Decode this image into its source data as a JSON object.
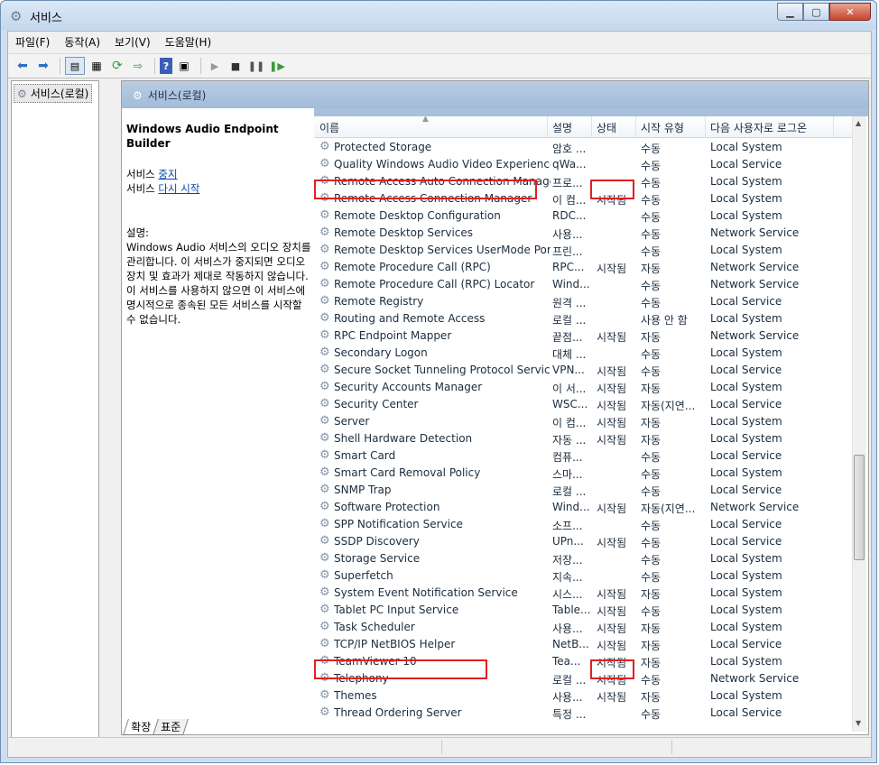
{
  "window": {
    "title": "서비스"
  },
  "menu": [
    "파일(F)",
    "동작(A)",
    "보기(V)",
    "도움말(H)"
  ],
  "tree": {
    "root": "서비스(로컬)"
  },
  "header": {
    "title": "서비스(로컬)"
  },
  "details": {
    "service_name": "Windows Audio Endpoint Builder",
    "stop_prefix": "서비스 ",
    "stop_link": "중지",
    "restart_prefix": "서비스 ",
    "restart_link": "다시 시작",
    "desc_label": "설명:",
    "description": "Windows Audio 서비스의 오디오 장치를 관리합니다. 이 서비스가 중지되면 오디오 장치 및 효과가 제대로 작동하지 않습니다. 이 서비스를 사용하지 않으면 이 서비스에 명시적으로 종속된 모든 서비스를 시작할 수 없습니다."
  },
  "columns": {
    "name": "이름",
    "desc": "설명",
    "status": "상태",
    "startup": "시작 유형",
    "logon": "다음 사용자로 로그온"
  },
  "rows": [
    {
      "name": "Protected Storage",
      "desc": "암호 ...",
      "status": "",
      "startup": "수동",
      "logon": "Local System"
    },
    {
      "name": "Quality Windows Audio Video Experience",
      "desc": "qWa...",
      "status": "",
      "startup": "수동",
      "logon": "Local Service"
    },
    {
      "name": "Remote Access Auto Connection Manager",
      "desc": "프로...",
      "status": "",
      "startup": "수동",
      "logon": "Local System"
    },
    {
      "name": "Remote Access Connection Manager",
      "desc": "이 컴...",
      "status": "시작됨",
      "startup": "수동",
      "logon": "Local System"
    },
    {
      "name": "Remote Desktop Configuration",
      "desc": "RDC...",
      "status": "",
      "startup": "수동",
      "logon": "Local System"
    },
    {
      "name": "Remote Desktop Services",
      "desc": "사용...",
      "status": "",
      "startup": "수동",
      "logon": "Network Service"
    },
    {
      "name": "Remote Desktop Services UserMode Port ...",
      "desc": "프린...",
      "status": "",
      "startup": "수동",
      "logon": "Local System"
    },
    {
      "name": "Remote Procedure Call (RPC)",
      "desc": "RPC...",
      "status": "시작됨",
      "startup": "자동",
      "logon": "Network Service"
    },
    {
      "name": "Remote Procedure Call (RPC) Locator",
      "desc": "Wind...",
      "status": "",
      "startup": "수동",
      "logon": "Network Service"
    },
    {
      "name": "Remote Registry",
      "desc": "원격 ...",
      "status": "",
      "startup": "수동",
      "logon": "Local Service"
    },
    {
      "name": "Routing and Remote Access",
      "desc": "로컬 ...",
      "status": "",
      "startup": "사용 안 함",
      "logon": "Local System"
    },
    {
      "name": "RPC Endpoint Mapper",
      "desc": "끝점...",
      "status": "시작됨",
      "startup": "자동",
      "logon": "Network Service"
    },
    {
      "name": "Secondary Logon",
      "desc": "대체 ...",
      "status": "",
      "startup": "수동",
      "logon": "Local System"
    },
    {
      "name": "Secure Socket Tunneling Protocol Service",
      "desc": "VPN...",
      "status": "시작됨",
      "startup": "수동",
      "logon": "Local Service"
    },
    {
      "name": "Security Accounts Manager",
      "desc": "이 서...",
      "status": "시작됨",
      "startup": "자동",
      "logon": "Local System"
    },
    {
      "name": "Security Center",
      "desc": "WSC...",
      "status": "시작됨",
      "startup": "자동(지연...",
      "logon": "Local Service"
    },
    {
      "name": "Server",
      "desc": "이 컴...",
      "status": "시작됨",
      "startup": "자동",
      "logon": "Local System"
    },
    {
      "name": "Shell Hardware Detection",
      "desc": "자동 ...",
      "status": "시작됨",
      "startup": "자동",
      "logon": "Local System"
    },
    {
      "name": "Smart Card",
      "desc": "컴퓨...",
      "status": "",
      "startup": "수동",
      "logon": "Local Service"
    },
    {
      "name": "Smart Card Removal Policy",
      "desc": "스마...",
      "status": "",
      "startup": "수동",
      "logon": "Local System"
    },
    {
      "name": "SNMP Trap",
      "desc": "로컬 ...",
      "status": "",
      "startup": "수동",
      "logon": "Local Service"
    },
    {
      "name": "Software Protection",
      "desc": "Wind...",
      "status": "시작됨",
      "startup": "자동(지연...",
      "logon": "Network Service"
    },
    {
      "name": "SPP Notification Service",
      "desc": "소프...",
      "status": "",
      "startup": "수동",
      "logon": "Local Service"
    },
    {
      "name": "SSDP Discovery",
      "desc": "UPn...",
      "status": "시작됨",
      "startup": "수동",
      "logon": "Local Service"
    },
    {
      "name": "Storage Service",
      "desc": "저장...",
      "status": "",
      "startup": "수동",
      "logon": "Local System"
    },
    {
      "name": "Superfetch",
      "desc": "지속...",
      "status": "",
      "startup": "수동",
      "logon": "Local System"
    },
    {
      "name": "System Event Notification Service",
      "desc": "시스...",
      "status": "시작됨",
      "startup": "자동",
      "logon": "Local System"
    },
    {
      "name": "Tablet PC Input Service",
      "desc": "Table...",
      "status": "시작됨",
      "startup": "수동",
      "logon": "Local System"
    },
    {
      "name": "Task Scheduler",
      "desc": "사용...",
      "status": "시작됨",
      "startup": "자동",
      "logon": "Local System"
    },
    {
      "name": "TCP/IP NetBIOS Helper",
      "desc": "NetB...",
      "status": "시작됨",
      "startup": "자동",
      "logon": "Local Service"
    },
    {
      "name": "TeamViewer 10",
      "desc": "Tea...",
      "status": "시작됨",
      "startup": "자동",
      "logon": "Local System"
    },
    {
      "name": "Telephony",
      "desc": "로컬 ...",
      "status": "시작됨",
      "startup": "수동",
      "logon": "Network Service"
    },
    {
      "name": "Themes",
      "desc": "사용...",
      "status": "시작됨",
      "startup": "자동",
      "logon": "Local System"
    },
    {
      "name": "Thread Ordering Server",
      "desc": "특정 ...",
      "status": "",
      "startup": "수동",
      "logon": "Local Service"
    }
  ],
  "tabs": [
    "확장",
    "표준"
  ],
  "icons": {
    "service": "gear-icon",
    "back": "back-arrow-icon",
    "forward": "forward-arrow-icon"
  }
}
